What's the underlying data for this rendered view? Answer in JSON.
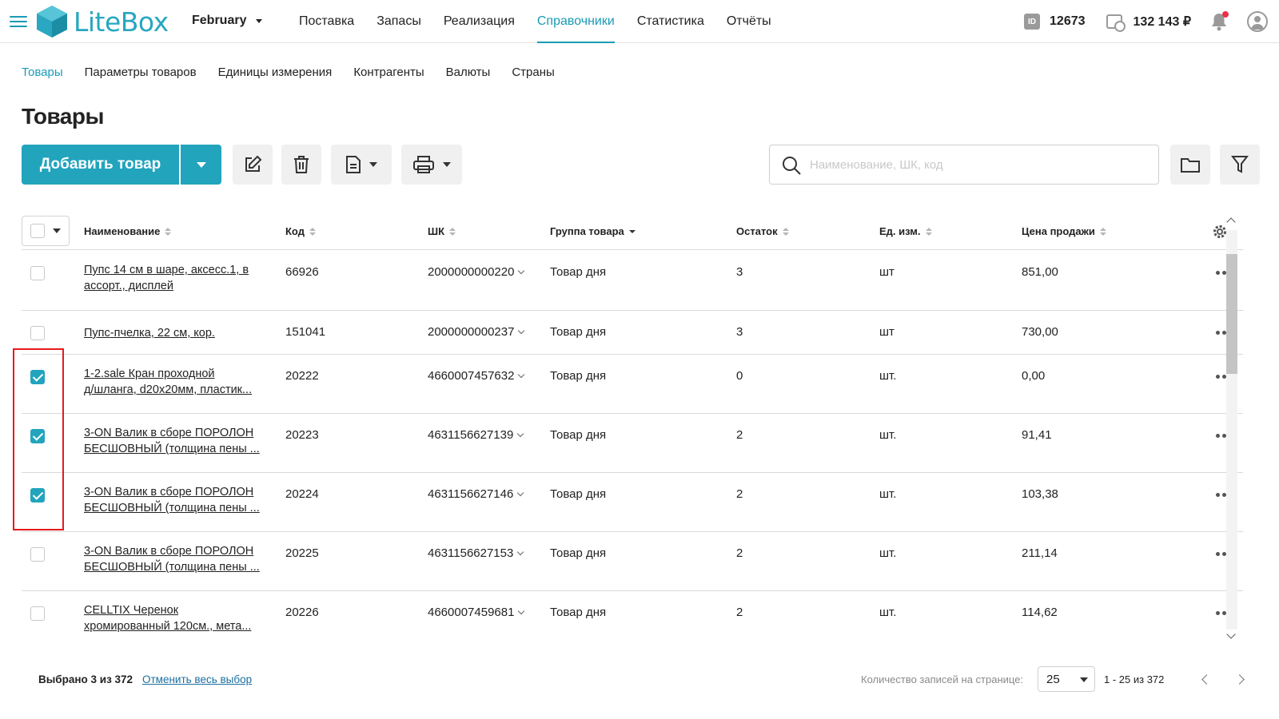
{
  "app": {
    "logo_text": "LiteBox",
    "month": "February",
    "nav": [
      "Поставка",
      "Запасы",
      "Реализация",
      "Справочники",
      "Статистика",
      "Отчёты"
    ],
    "active_nav": "Справочники",
    "id_badge": "ID",
    "account_id": "12673",
    "balance": "132 143 ₽",
    "accent": "#1a9bb5",
    "notification_dot_color": "#e8334a"
  },
  "subnav": {
    "items": [
      "Товары",
      "Параметры товаров",
      "Единицы измерения",
      "Контрагенты",
      "Валюты",
      "Страны"
    ],
    "active": "Товары"
  },
  "page": {
    "title": "Товары"
  },
  "toolbar": {
    "add_label": "Добавить товар",
    "icons": [
      "edit-icon",
      "trash-icon",
      "document-icon",
      "printer-icon",
      "folder-icon",
      "filter-icon"
    ]
  },
  "search": {
    "placeholder": "Наименование, ШК, код",
    "value": ""
  },
  "table": {
    "columns": [
      "Наименование",
      "Код",
      "ШК",
      "Группа товара",
      "Остаток",
      "Ед. изм.",
      "Цена продажи"
    ],
    "sorted_column": "Группа товара",
    "rows": [
      {
        "checked": false,
        "name_line1": "Пупс 14 см в шаре, аксесс.1, в",
        "name_line2": "ассорт., дисплей",
        "code": "66926",
        "barcode": "2000000000220",
        "group": "Товар дня",
        "stock": "3",
        "unit": "шт",
        "price": "851,00"
      },
      {
        "checked": false,
        "name_line1": "Пупс-пчелка, 22 см, кор.",
        "name_line2": "",
        "code": "151041",
        "barcode": "2000000000237",
        "group": "Товар дня",
        "stock": "3",
        "unit": "шт",
        "price": "730,00"
      },
      {
        "checked": true,
        "name_line1": "1-2.sale Кран проходной",
        "name_line2": "д/шланга, d20x20мм, пластик...",
        "code": "20222",
        "barcode": "4660007457632",
        "group": "Товар дня",
        "stock": "0",
        "unit": "шт.",
        "price": "0,00"
      },
      {
        "checked": true,
        "name_line1": "3-ON Валик в сборе ПОРОЛОН",
        "name_line2": "БЕСШОВНЫЙ (толщина пены ...",
        "code": "20223",
        "barcode": "4631156627139",
        "group": "Товар дня",
        "stock": "2",
        "unit": "шт.",
        "price": "91,41"
      },
      {
        "checked": true,
        "name_line1": "3-ON Валик в сборе ПОРОЛОН",
        "name_line2": "БЕСШОВНЫЙ (толщина пены ...",
        "code": "20224",
        "barcode": "4631156627146",
        "group": "Товар дня",
        "stock": "2",
        "unit": "шт.",
        "price": "103,38"
      },
      {
        "checked": false,
        "name_line1": "3-ON Валик в сборе ПОРОЛОН",
        "name_line2": "БЕСШОВНЫЙ (толщина пены ...",
        "code": "20225",
        "barcode": "4631156627153",
        "group": "Товар дня",
        "stock": "2",
        "unit": "шт.",
        "price": "211,14"
      },
      {
        "checked": false,
        "name_line1": "CELLTIX Черенок",
        "name_line2": "хромированный 120см., мета...",
        "code": "20226",
        "barcode": "4660007459681",
        "group": "Товар дня",
        "stock": "2",
        "unit": "шт.",
        "price": "114,62"
      }
    ]
  },
  "footer": {
    "selected_text": "Выбрано 3 из 372",
    "cancel_label": "Отменить весь выбор",
    "per_page_label": "Количество записей на странице:",
    "per_page_value": "25",
    "range": "1 - 25 из 372"
  }
}
